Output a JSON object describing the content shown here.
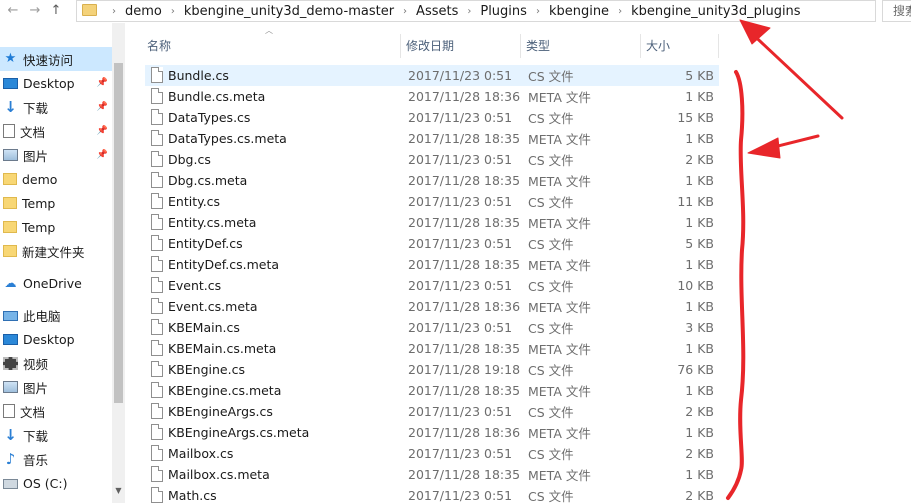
{
  "address_bar": {
    "breadcrumbs": [
      "demo",
      "kbengine_unity3d_demo-master",
      "Assets",
      "Plugins",
      "kbengine",
      "kbengine_unity3d_plugins"
    ],
    "search_placeholder": "搜索"
  },
  "nav_pane": {
    "items": [
      {
        "label": "快速访问",
        "icon": "star-icon",
        "selected": true,
        "pinned": false
      },
      {
        "label": "Desktop",
        "icon": "desktop-icon",
        "selected": false,
        "pinned": true
      },
      {
        "label": "下载",
        "icon": "download-icon",
        "selected": false,
        "pinned": true
      },
      {
        "label": "文档",
        "icon": "document-icon",
        "selected": false,
        "pinned": true
      },
      {
        "label": "图片",
        "icon": "pictures-icon",
        "selected": false,
        "pinned": true
      },
      {
        "label": "demo",
        "icon": "folder-icon",
        "selected": false,
        "pinned": false
      },
      {
        "label": "Temp",
        "icon": "folder-icon",
        "selected": false,
        "pinned": false
      },
      {
        "label": "Temp",
        "icon": "folder-icon",
        "selected": false,
        "pinned": false
      },
      {
        "label": "新建文件夹",
        "icon": "folder-icon",
        "selected": false,
        "pinned": false
      },
      {
        "label": "OneDrive",
        "icon": "cloud-icon",
        "selected": false,
        "pinned": false
      },
      {
        "label": "此电脑",
        "icon": "computer-icon",
        "selected": false,
        "pinned": false
      },
      {
        "label": "Desktop",
        "icon": "desktop-icon",
        "selected": false,
        "pinned": false
      },
      {
        "label": "视频",
        "icon": "video-icon",
        "selected": false,
        "pinned": false
      },
      {
        "label": "图片",
        "icon": "pictures-icon",
        "selected": false,
        "pinned": false
      },
      {
        "label": "文档",
        "icon": "document-icon",
        "selected": false,
        "pinned": false
      },
      {
        "label": "下载",
        "icon": "download-icon",
        "selected": false,
        "pinned": false
      },
      {
        "label": "音乐",
        "icon": "music-icon",
        "selected": false,
        "pinned": false
      },
      {
        "label": "OS (C:)",
        "icon": "drive-icon",
        "selected": false,
        "pinned": false
      }
    ]
  },
  "file_list": {
    "columns": {
      "name": "名称",
      "date": "修改日期",
      "type": "类型",
      "size": "大小"
    },
    "rows": [
      {
        "name": "Bundle.cs",
        "date": "2017/11/23 0:51",
        "type": "CS 文件",
        "size": "5 KB",
        "selected": true
      },
      {
        "name": "Bundle.cs.meta",
        "date": "2017/11/28 18:36",
        "type": "META 文件",
        "size": "1 KB"
      },
      {
        "name": "DataTypes.cs",
        "date": "2017/11/23 0:51",
        "type": "CS 文件",
        "size": "15 KB"
      },
      {
        "name": "DataTypes.cs.meta",
        "date": "2017/11/28 18:35",
        "type": "META 文件",
        "size": "1 KB"
      },
      {
        "name": "Dbg.cs",
        "date": "2017/11/23 0:51",
        "type": "CS 文件",
        "size": "2 KB"
      },
      {
        "name": "Dbg.cs.meta",
        "date": "2017/11/28 18:35",
        "type": "META 文件",
        "size": "1 KB"
      },
      {
        "name": "Entity.cs",
        "date": "2017/11/23 0:51",
        "type": "CS 文件",
        "size": "11 KB"
      },
      {
        "name": "Entity.cs.meta",
        "date": "2017/11/28 18:35",
        "type": "META 文件",
        "size": "1 KB"
      },
      {
        "name": "EntityDef.cs",
        "date": "2017/11/23 0:51",
        "type": "CS 文件",
        "size": "5 KB"
      },
      {
        "name": "EntityDef.cs.meta",
        "date": "2017/11/28 18:35",
        "type": "META 文件",
        "size": "1 KB"
      },
      {
        "name": "Event.cs",
        "date": "2017/11/23 0:51",
        "type": "CS 文件",
        "size": "10 KB"
      },
      {
        "name": "Event.cs.meta",
        "date": "2017/11/28 18:36",
        "type": "META 文件",
        "size": "1 KB"
      },
      {
        "name": "KBEMain.cs",
        "date": "2017/11/23 0:51",
        "type": "CS 文件",
        "size": "3 KB"
      },
      {
        "name": "KBEMain.cs.meta",
        "date": "2017/11/28 18:35",
        "type": "META 文件",
        "size": "1 KB"
      },
      {
        "name": "KBEngine.cs",
        "date": "2017/11/28 19:18",
        "type": "CS 文件",
        "size": "76 KB"
      },
      {
        "name": "KBEngine.cs.meta",
        "date": "2017/11/28 18:35",
        "type": "META 文件",
        "size": "1 KB"
      },
      {
        "name": "KBEngineArgs.cs",
        "date": "2017/11/23 0:51",
        "type": "CS 文件",
        "size": "2 KB"
      },
      {
        "name": "KBEngineArgs.cs.meta",
        "date": "2017/11/28 18:36",
        "type": "META 文件",
        "size": "1 KB"
      },
      {
        "name": "Mailbox.cs",
        "date": "2017/11/23 0:51",
        "type": "CS 文件",
        "size": "2 KB"
      },
      {
        "name": "Mailbox.cs.meta",
        "date": "2017/11/28 18:35",
        "type": "META 文件",
        "size": "1 KB"
      },
      {
        "name": "Math.cs",
        "date": "2017/11/23 0:51",
        "type": "CS 文件",
        "size": "2 KB"
      }
    ]
  },
  "annotations": {
    "color": "#e8262a"
  }
}
